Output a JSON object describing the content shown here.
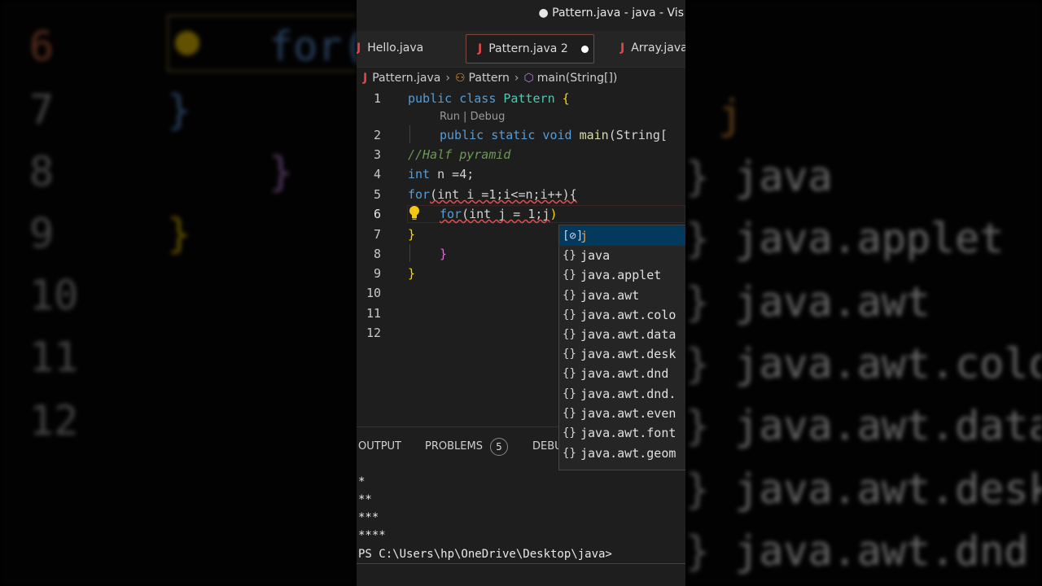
{
  "window": {
    "title": "● Pattern.java - java - Vis"
  },
  "tabs": [
    {
      "label": "Hello.java",
      "icon": "java-file-icon",
      "active": false
    },
    {
      "label": "Pattern.java 2",
      "icon": "java-file-icon",
      "active": true,
      "modified": true
    },
    {
      "label": "Array.java",
      "icon": "java-file-icon",
      "active": false
    }
  ],
  "breadcrumb": {
    "file": "Pattern.java",
    "class": "Pattern",
    "method": "main(String[])"
  },
  "editor": {
    "line_numbers": [
      "1",
      "2",
      "3",
      "4",
      "5",
      "6",
      "7",
      "8",
      "9",
      "10",
      "11",
      "12"
    ],
    "codelens": "Run | Debug",
    "code": {
      "l1_kw": "public class ",
      "l1_cls": "Pattern",
      "l1_br": " {",
      "l2_kw": "public static void ",
      "l2_fn": "main",
      "l2_rest": "(String[",
      "l3": "//Half pyramid",
      "l4_kw": "int",
      "l4_rest": " n =4;",
      "l5_kw": "for",
      "l5_rest": "(int i =1;i<=n;i++){",
      "l6_kw": "for",
      "l6_rest": "(int j = 1;j",
      "l6_close": ")",
      "l7": "}",
      "l8": "}",
      "l9": "}"
    }
  },
  "suggest": {
    "items": [
      {
        "icon": "[⊘]",
        "label": "j",
        "selected": true
      },
      {
        "icon": "{}",
        "label": "java"
      },
      {
        "icon": "{}",
        "label": "java.applet"
      },
      {
        "icon": "{}",
        "label": "java.awt"
      },
      {
        "icon": "{}",
        "label": "java.awt.colo"
      },
      {
        "icon": "{}",
        "label": "java.awt.data"
      },
      {
        "icon": "{}",
        "label": "java.awt.desk"
      },
      {
        "icon": "{}",
        "label": "java.awt.dnd"
      },
      {
        "icon": "{}",
        "label": "java.awt.dnd."
      },
      {
        "icon": "{}",
        "label": "java.awt.even"
      },
      {
        "icon": "{}",
        "label": "java.awt.font"
      },
      {
        "icon": "{}",
        "label": "java.awt.geom"
      }
    ]
  },
  "panel": {
    "tabs": {
      "output": "OUTPUT",
      "problems": "PROBLEMS",
      "problems_count": "5",
      "debug": "DEBU"
    },
    "output_lines": [
      "*",
      "**",
      "***",
      "****"
    ],
    "prompt": "PS C:\\Users\\hp\\OneDrive\\Desktop\\java>"
  },
  "background": {
    "left_numbers": [
      "6",
      "7",
      "8",
      "9",
      "10",
      "11",
      "12"
    ],
    "left_code_6": "for(",
    "left_code_7": "}",
    "left_code_8": "}",
    "left_code_9": "}",
    "right_top": "j",
    "right_items": [
      "java",
      "java.applet",
      "java.awt",
      "java.awt.colo",
      "java.awt.data",
      "java.awt.desk",
      "java.awt.dnd"
    ]
  }
}
